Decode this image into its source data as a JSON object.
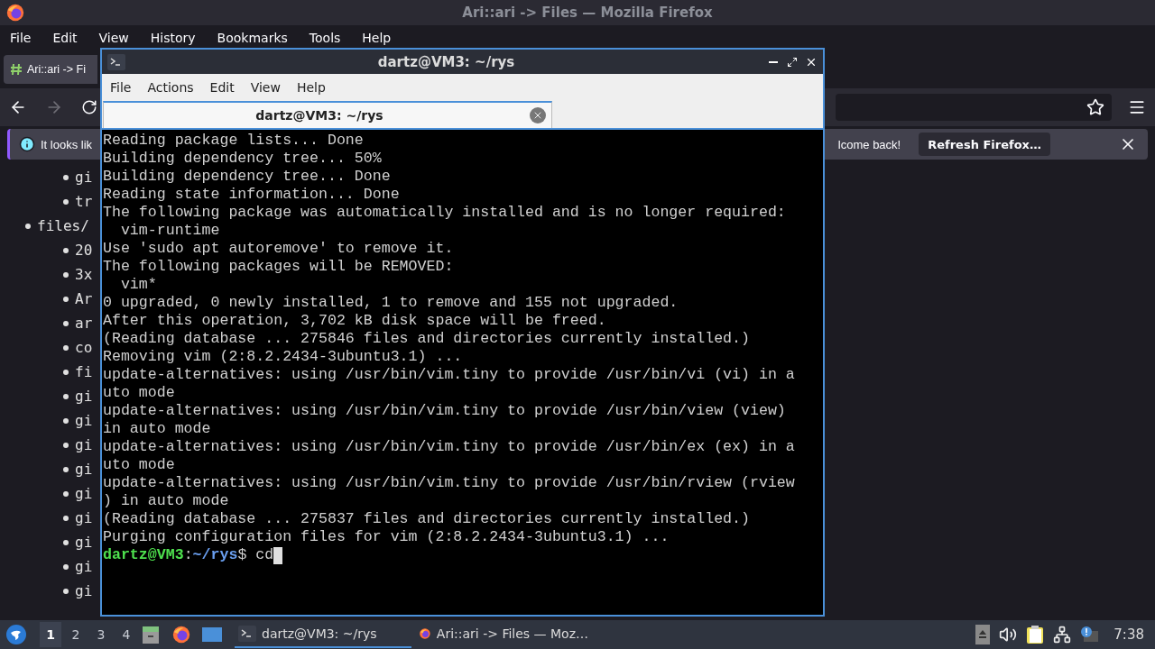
{
  "firefox": {
    "title": "Ari::ari -> Files — Mozilla Firefox",
    "menu": [
      "File",
      "Edit",
      "View",
      "History",
      "Bookmarks",
      "Tools",
      "Help"
    ],
    "tabs": [
      {
        "title": "Ari::ari -> Fi",
        "selected": true
      }
    ],
    "nav_buttons": [
      {
        "kind": "back",
        "disabled": false
      },
      {
        "kind": "forward",
        "disabled": true
      },
      {
        "kind": "reload",
        "disabled": false
      }
    ],
    "notification": {
      "text_start": "It looks lik",
      "text_end": "lcome back!",
      "button": "Refresh Firefox…"
    },
    "page_list": [
      {
        "children": [
          {
            "text": "gi"
          },
          {
            "text": "tr"
          }
        ]
      },
      {
        "text": "files/",
        "children": [
          {
            "text": "20"
          },
          {
            "text": "3x"
          },
          {
            "text": "Ar"
          },
          {
            "text": "ar"
          },
          {
            "text": "co"
          },
          {
            "text": "fi"
          },
          {
            "text": "gi"
          },
          {
            "text": "gi"
          },
          {
            "text": "gi"
          },
          {
            "text": "gi"
          },
          {
            "text": "gi"
          },
          {
            "text": "gi"
          },
          {
            "text": "gi"
          },
          {
            "text": "gi"
          },
          {
            "text": "gi"
          }
        ]
      }
    ]
  },
  "terminal": {
    "title": "dartz@VM3: ~/rys",
    "menu": [
      "File",
      "Actions",
      "Edit",
      "View",
      "Help"
    ],
    "tabs": [
      {
        "title": "dartz@VM3: ~/rys",
        "selected": true
      }
    ],
    "lines": [
      "Reading package lists... Done",
      "Building dependency tree... 50%",
      "Building dependency tree... Done",
      "Reading state information... Done",
      "The following package was automatically installed and is no longer required:",
      "  vim-runtime",
      "Use 'sudo apt autoremove' to remove it.",
      "The following packages will be REMOVED:",
      "  vim*",
      "0 upgraded, 0 newly installed, 1 to remove and 155 not upgraded.",
      "After this operation, 3,702 kB disk space will be freed.",
      "(Reading database ... 275846 files and directories currently installed.)",
      "Removing vim (2:8.2.2434-3ubuntu3.1) ...",
      "update-alternatives: using /usr/bin/vim.tiny to provide /usr/bin/vi (vi) in a",
      "uto mode",
      "update-alternatives: using /usr/bin/vim.tiny to provide /usr/bin/view (view)",
      "in auto mode",
      "update-alternatives: using /usr/bin/vim.tiny to provide /usr/bin/ex (ex) in a",
      "uto mode",
      "update-alternatives: using /usr/bin/vim.tiny to provide /usr/bin/rview (rview",
      ") in auto mode",
      "(Reading database ... 275837 files and directories currently installed.)",
      "Purging configuration files for vim (2:8.2.2434-3ubuntu3.1) ..."
    ],
    "prompt": {
      "user_host": "dartz@VM3",
      "separator": ":",
      "path": "~/rys",
      "symbol": "$",
      "command": "cd"
    }
  },
  "taskbar": {
    "workspaces": [
      {
        "label": "1",
        "selected": true
      },
      {
        "label": "2",
        "selected": false
      },
      {
        "label": "3",
        "selected": false
      },
      {
        "label": "4",
        "selected": false
      }
    ],
    "tasks": [
      {
        "title": "dartz@VM3: ~/rys",
        "kind": "terminal",
        "selected": true
      },
      {
        "title": "Ari::ari -> Files — Moz…",
        "kind": "browser",
        "selected": false
      }
    ],
    "clock": "7:38"
  }
}
